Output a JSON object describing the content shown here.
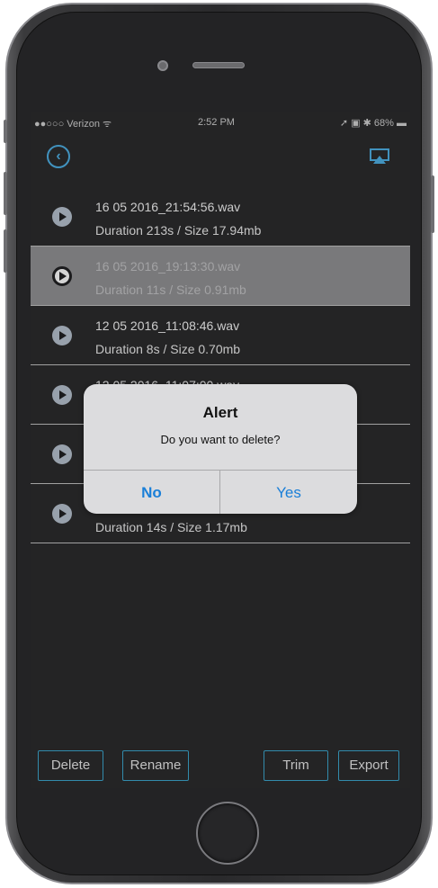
{
  "status_bar": {
    "carrier": "●●○○○ Verizon ᯤ",
    "time": "2:52 PM",
    "battery": "➚ ▣ ✱ 68% ▬"
  },
  "nav": {
    "back_icon": "chevron-left-icon",
    "airplay_icon": "airplay-icon",
    "accent_color": "#4ba7d9"
  },
  "recordings": [
    {
      "name": "16 05 2016_21:54:56.wav",
      "meta": "Duration 213s / Size 17.94mb",
      "selected": false
    },
    {
      "name": "16 05 2016_19:13:30.wav",
      "meta": "Duration 11s / Size 0.91mb",
      "selected": true
    },
    {
      "name": "12 05 2016_11:08:46.wav",
      "meta": "Duration 8s / Size 0.70mb",
      "selected": false
    },
    {
      "name": "12 05 2016_11:07:00.wav",
      "meta": "",
      "selected": false
    },
    {
      "name": "",
      "meta": "",
      "selected": false
    },
    {
      "name": "",
      "meta": "Duration 14s / Size 1.17mb",
      "selected": false
    }
  ],
  "toolbar": {
    "delete_label": "Delete",
    "rename_label": "Rename",
    "trim_label": "Trim",
    "export_label": "Export"
  },
  "alert": {
    "title": "Alert",
    "message": "Do you want to delete?",
    "no_label": "No",
    "yes_label": "Yes",
    "button_color": "#1a7fd8"
  }
}
